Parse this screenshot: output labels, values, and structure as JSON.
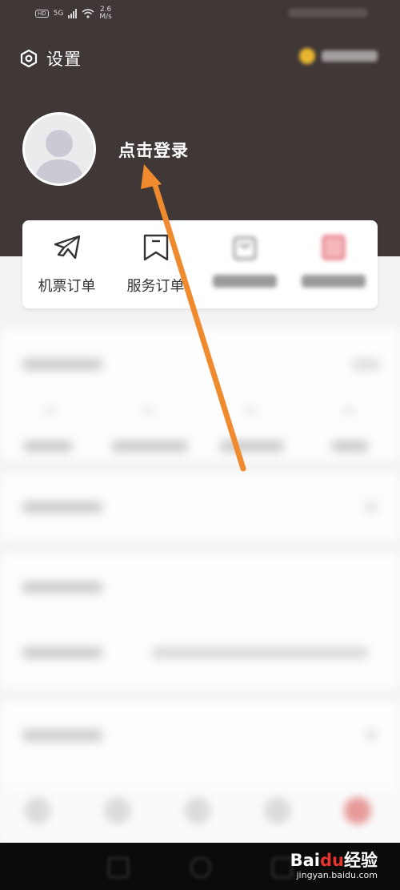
{
  "status_bar": {
    "hd": "HD",
    "network": "5G",
    "speed_value": "2.6",
    "speed_unit": "M/s"
  },
  "header": {
    "settings_label": "设置",
    "login_label": "点击登录"
  },
  "orders": [
    {
      "label": "机票订单",
      "icon": "airplane-icon"
    },
    {
      "label": "服务订单",
      "icon": "bookmark-icon"
    }
  ],
  "watermark": {
    "logo_a": "Bai",
    "logo_b": "du",
    "logo_c": "经验",
    "url": "jingyan.baidu.com"
  },
  "colors": {
    "header_bg": "#3f3837",
    "arrow": "#f08a2e",
    "page_bg": "#f3f3f3"
  }
}
